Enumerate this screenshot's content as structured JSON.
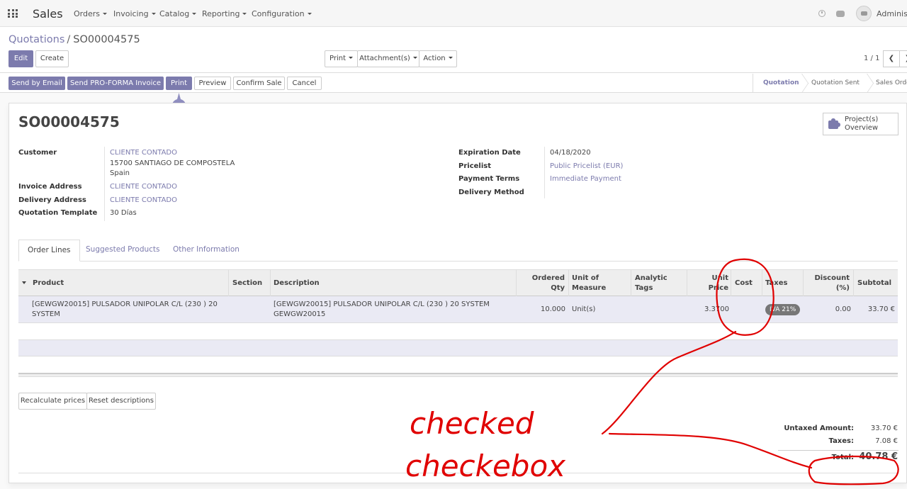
{
  "navbar": {
    "brand": "Sales",
    "menus": [
      "Orders",
      "Invoicing",
      "Catalog",
      "Reporting",
      "Configuration"
    ],
    "username": "Administr"
  },
  "breadcrumb": {
    "parent": "Quotations",
    "separator": "/",
    "current": "SO00004575"
  },
  "control": {
    "edit": "Edit",
    "create": "Create",
    "print": "Print",
    "attachments": "Attachment(s)",
    "action": "Action",
    "pager": "1 / 1"
  },
  "header_buttons": {
    "send_email": "Send by Email",
    "send_proforma": "Send PRO-FORMA Invoice",
    "print": "Print",
    "preview": "Preview",
    "confirm": "Confirm Sale",
    "cancel": "Cancel"
  },
  "stages": [
    "Quotation",
    "Quotation Sent",
    "Sales Order"
  ],
  "record": {
    "title": "SO00004575",
    "smart_button": {
      "line1": "Project(s)",
      "line2": "Overview"
    },
    "left": {
      "customer_label": "Customer",
      "customer_name": "CLIENTE CONTADO",
      "customer_line2": "15700 SANTIAGO DE COMPOSTELA",
      "customer_line3": "Spain",
      "invoice_label": "Invoice Address",
      "invoice_value": "CLIENTE CONTADO",
      "delivery_label": "Delivery Address",
      "delivery_value": "CLIENTE CONTADO",
      "template_label": "Quotation Template",
      "template_value": "30 Días"
    },
    "right": {
      "expiration_label": "Expiration Date",
      "expiration_value": "04/18/2020",
      "pricelist_label": "Pricelist",
      "pricelist_value": "Public Pricelist (EUR)",
      "terms_label": "Payment Terms",
      "terms_value": "Immediate Payment",
      "delivery_method_label": "Delivery Method"
    }
  },
  "tabs": [
    "Order Lines",
    "Suggested Products",
    "Other Information"
  ],
  "table": {
    "headers": {
      "product": "Product",
      "section": "Section",
      "description": "Description",
      "qty_1": "Ordered",
      "qty_2": "Qty",
      "uom_1": "Unit of",
      "uom_2": "Measure",
      "tags_1": "Analytic",
      "tags_2": "Tags",
      "price_1": "Unit",
      "price_2": "Price",
      "cost": "Cost",
      "taxes": "Taxes",
      "discount_1": "Discount",
      "discount_2": "(%)",
      "subtotal": "Subtotal"
    },
    "rows": [
      {
        "product_1": "[GEWGW20015] PULSADOR UNIPOLAR C/L (230 ) 20",
        "product_2": "SYSTEM",
        "description_1": "[GEWGW20015] PULSADOR UNIPOLAR C/L (230 ) 20 SYSTEM",
        "description_2": "GEWGW20015",
        "qty": "10.000",
        "uom": "Unit(s)",
        "price": "3.3700",
        "tax": "IVA 21%",
        "discount": "0.00",
        "subtotal": "33.70 €"
      }
    ]
  },
  "line_buttons": {
    "recalculate": "Recalculate prices",
    "reset": "Reset descriptions"
  },
  "totals": {
    "untaxed_label": "Untaxed Amount:",
    "untaxed_value": "33.70 €",
    "taxes_label": "Taxes:",
    "taxes_value": "7.08 €",
    "total_label": "Total:",
    "total_value": "40.78 €"
  },
  "annotation": {
    "line1": "checked",
    "line2": "checkebox",
    "color": "#e00000"
  },
  "colors": {
    "primary": "#7c7bad",
    "row_highlight": "#eaeaf4"
  }
}
